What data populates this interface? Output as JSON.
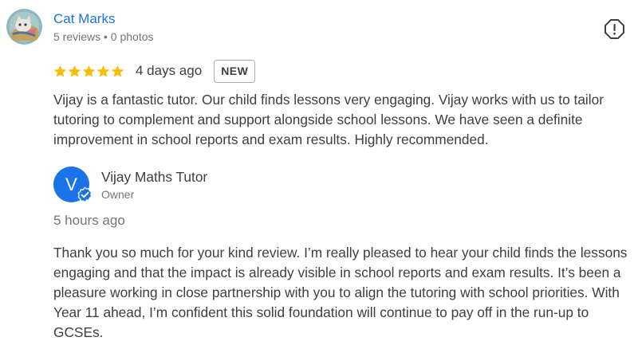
{
  "reviewer": {
    "name": "Cat Marks",
    "meta": "5 reviews • 0 photos",
    "avatar_icon": "cat-illustration-avatar"
  },
  "review": {
    "rating": 5,
    "max_rating": 5,
    "star_color": "#fbbc04",
    "time_ago": "4 days ago",
    "badge": "NEW",
    "text": "Vijay is a fantastic tutor. Our child finds lessons very engaging. Vijay works with us to tailor tutoring to complement and support alongside school lessons. We have seen a definite improvement in school reports and exam results. Highly recommended."
  },
  "reply": {
    "avatar_initial": "V",
    "avatar_color": "#1a73e8",
    "owner_name": "Vijay Maths Tutor",
    "owner_role": "Owner",
    "time_ago": "5 hours ago",
    "text": "Thank you so much for your kind review. I’m really pleased to hear your child finds the lessons engaging and that the impact is already visible in school reports and exam results. It’s been a pleasure working in close partnership with you to align the tutoring with school priorities. With Year 11 ahead, I’m confident this solid foundation will continue to pay off in the run-up to GCSEs."
  },
  "icons": {
    "report": "report-icon",
    "verified": "verified-check-icon"
  }
}
